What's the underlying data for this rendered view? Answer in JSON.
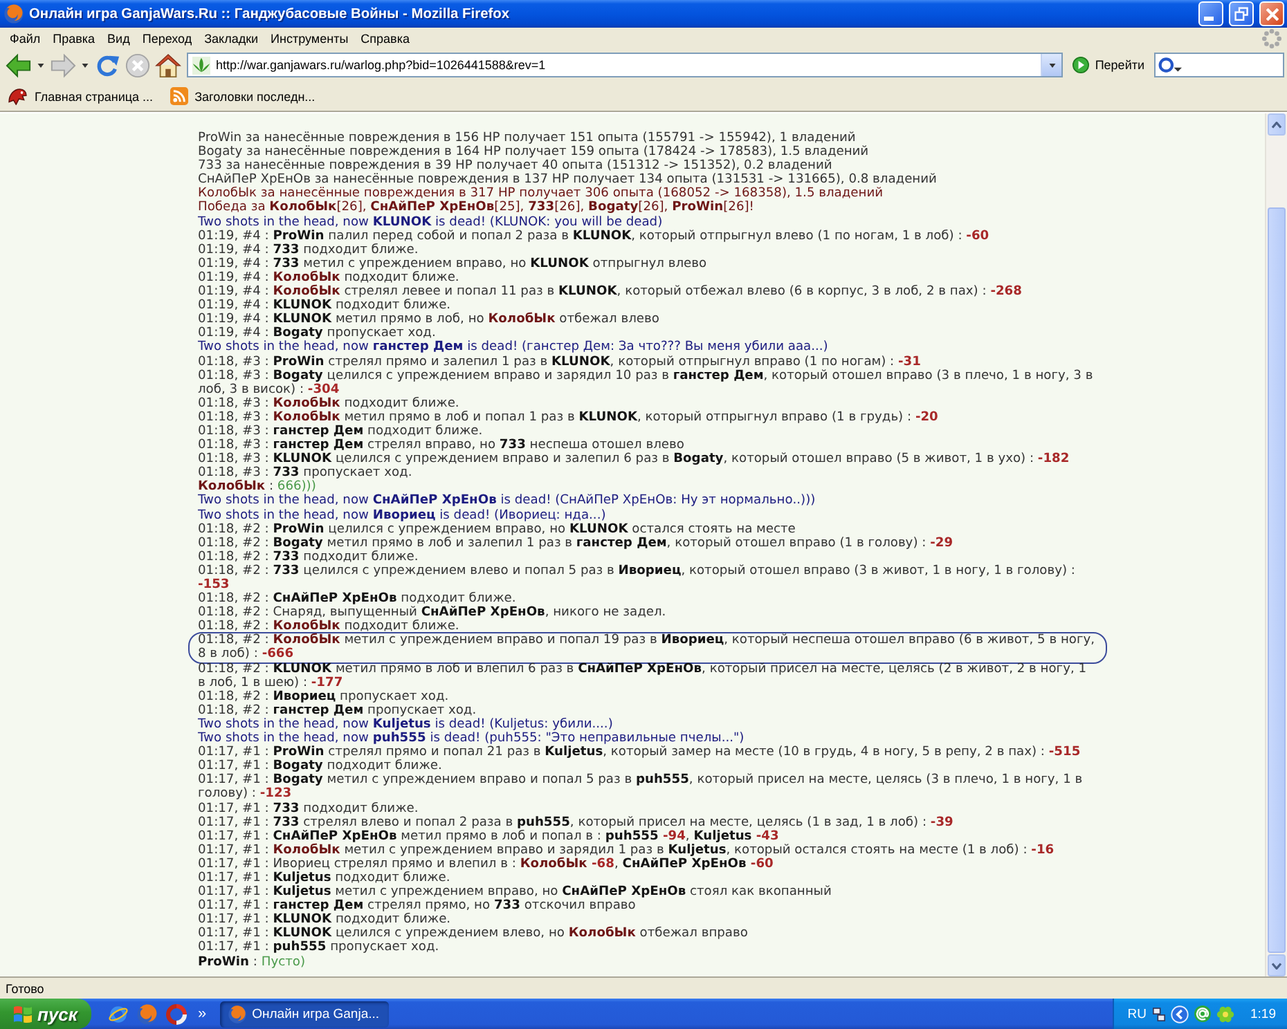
{
  "window": {
    "title": "Онлайн игра GanjaWars.Ru :: Ганджубасовые Войны - Mozilla Firefox"
  },
  "menu": [
    "Файл",
    "Правка",
    "Вид",
    "Переход",
    "Закладки",
    "Инструменты",
    "Справка"
  ],
  "navigation": {
    "buttons": [
      {
        "kind": "back",
        "disabled": false
      },
      {
        "kind": "forward",
        "disabled": true
      },
      {
        "kind": "reload",
        "disabled": false
      },
      {
        "kind": "stop",
        "disabled": true
      },
      {
        "kind": "home",
        "disabled": false
      }
    ],
    "url": "http://war.ganjawars.ru/warlog.php?bid=1026441588&rev=1",
    "go_label": "Перейти"
  },
  "bookmarks": [
    {
      "kind": "site",
      "label": "Главная страница ..."
    },
    {
      "kind": "feed",
      "label": "Заголовки последн..."
    }
  ],
  "log": {
    "lines": [
      {
        "kind": "summary",
        "circled": false,
        "parts": [
          {
            "kind": "text",
            "text": "ProWin за нанесённые повреждения в 156 HP получает 151 опыта (155791 -> 155942), 1 владений"
          }
        ]
      },
      {
        "kind": "summary",
        "circled": false,
        "parts": [
          {
            "kind": "text",
            "text": "Bogaty за нанесённые повреждения в 164 HP получает 159 опыта (178424 -> 178583), 1.5 владений"
          }
        ]
      },
      {
        "kind": "summary",
        "circled": false,
        "parts": [
          {
            "kind": "text",
            "text": "733 за нанесённые повреждения в 39 HP получает 40 опыта (151312 -> 151352), 0.2 владений"
          }
        ]
      },
      {
        "kind": "summary",
        "circled": false,
        "parts": [
          {
            "kind": "text",
            "text": "СнАйПеР ХрЕнОв за нанесённые повреждения в 137 HP получает 134 опыта (131531 -> 131665), 0.8 владений"
          }
        ]
      },
      {
        "kind": "own_summary",
        "circled": false,
        "parts": [
          {
            "kind": "text",
            "text": "КолобЫк за нанесённые повреждения в 317 HP получает 306 опыта (168052 -> 168358), 1.5 владений"
          }
        ]
      },
      {
        "kind": "victory",
        "circled": false,
        "parts": [
          {
            "kind": "text",
            "text": "Победа за "
          },
          {
            "kind": "name",
            "text": "КолобЫк"
          },
          {
            "kind": "text",
            "text": "[26], "
          },
          {
            "kind": "name",
            "text": "СнАйПеР ХрЕнОв"
          },
          {
            "kind": "text",
            "text": "[25], "
          },
          {
            "kind": "name",
            "text": "733"
          },
          {
            "kind": "text",
            "text": "[26], "
          },
          {
            "kind": "name",
            "text": "Bogaty"
          },
          {
            "kind": "text",
            "text": "[26], "
          },
          {
            "kind": "name",
            "text": "ProWin"
          },
          {
            "kind": "text",
            "text": "[26]!"
          }
        ]
      },
      {
        "kind": "death",
        "circled": false,
        "parts": [
          {
            "kind": "text",
            "text": "Two shots in the head, now "
          },
          {
            "kind": "name",
            "text": "KLUNOK"
          },
          {
            "kind": "text",
            "text": " is dead! (KLUNOK: you will be dead)"
          }
        ]
      },
      {
        "kind": "action",
        "circled": false,
        "parts": [
          {
            "kind": "text",
            "text": "01:19, #4 : "
          },
          {
            "kind": "name",
            "text": "ProWin"
          },
          {
            "kind": "text",
            "text": " палил перед собой и попал 2 раза в "
          },
          {
            "kind": "name",
            "text": "KLUNOK"
          },
          {
            "kind": "text",
            "text": ", который отпрыгнул влево (1 по ногам, 1 в лоб) : "
          },
          {
            "kind": "damage",
            "text": "-60"
          }
        ]
      },
      {
        "kind": "action",
        "circled": false,
        "parts": [
          {
            "kind": "text",
            "text": "01:19, #4 : "
          },
          {
            "kind": "name",
            "text": "733"
          },
          {
            "kind": "text",
            "text": " подходит ближе."
          }
        ]
      },
      {
        "kind": "action",
        "circled": false,
        "parts": [
          {
            "kind": "text",
            "text": "01:19, #4 : "
          },
          {
            "kind": "name",
            "text": "733"
          },
          {
            "kind": "text",
            "text": " метил с упреждением вправо, но "
          },
          {
            "kind": "name",
            "text": "KLUNOK"
          },
          {
            "kind": "text",
            "text": " отпрыгнул влево"
          }
        ]
      },
      {
        "kind": "action",
        "circled": false,
        "parts": [
          {
            "kind": "text",
            "text": "01:19, #4 : "
          },
          {
            "kind": "own_name",
            "text": "КолобЫк"
          },
          {
            "kind": "text",
            "text": " подходит ближе."
          }
        ]
      },
      {
        "kind": "action",
        "circled": false,
        "parts": [
          {
            "kind": "text",
            "text": "01:19, #4 : "
          },
          {
            "kind": "own_name",
            "text": "КолобЫк"
          },
          {
            "kind": "text",
            "text": " стрелял левее и попал 11 раз в "
          },
          {
            "kind": "name",
            "text": "KLUNOK"
          },
          {
            "kind": "text",
            "text": ", который отбежал влево (6 в корпус, 3 в лоб, 2 в пах) : "
          },
          {
            "kind": "damage",
            "text": "-268"
          }
        ]
      },
      {
        "kind": "action",
        "circled": false,
        "parts": [
          {
            "kind": "text",
            "text": "01:19, #4 : "
          },
          {
            "kind": "name",
            "text": "KLUNOK"
          },
          {
            "kind": "text",
            "text": " подходит ближе."
          }
        ]
      },
      {
        "kind": "action",
        "circled": false,
        "parts": [
          {
            "kind": "text",
            "text": "01:19, #4 : "
          },
          {
            "kind": "name",
            "text": "KLUNOK"
          },
          {
            "kind": "text",
            "text": " метил прямо в лоб, но "
          },
          {
            "kind": "own_name",
            "text": "КолобЫк"
          },
          {
            "kind": "text",
            "text": " отбежал влево"
          }
        ]
      },
      {
        "kind": "action",
        "circled": false,
        "parts": [
          {
            "kind": "text",
            "text": "01:19, #4 : "
          },
          {
            "kind": "name",
            "text": "Bogaty"
          },
          {
            "kind": "text",
            "text": " пропускает ход."
          }
        ]
      },
      {
        "kind": "death",
        "circled": false,
        "parts": [
          {
            "kind": "text",
            "text": "Two shots in the head, now "
          },
          {
            "kind": "name",
            "text": "ганстер Дем"
          },
          {
            "kind": "text",
            "text": " is dead! (ганстер Дем: За что??? Вы меня убили ааа...)"
          }
        ]
      },
      {
        "kind": "action",
        "circled": false,
        "parts": [
          {
            "kind": "text",
            "text": "01:18, #3 : "
          },
          {
            "kind": "name",
            "text": "ProWin"
          },
          {
            "kind": "text",
            "text": " стрелял прямо и залепил 1 раз в "
          },
          {
            "kind": "name",
            "text": "KLUNOK"
          },
          {
            "kind": "text",
            "text": ", который отпрыгнул вправо (1 по ногам) : "
          },
          {
            "kind": "damage",
            "text": "-31"
          }
        ]
      },
      {
        "kind": "action",
        "circled": false,
        "parts": [
          {
            "kind": "text",
            "text": "01:18, #3 : "
          },
          {
            "kind": "name",
            "text": "Bogaty"
          },
          {
            "kind": "text",
            "text": " целился с упреждением вправо и зарядил 10 раз в "
          },
          {
            "kind": "name",
            "text": "ганстер Дем"
          },
          {
            "kind": "text",
            "text": ", который отошел вправо (3 в плечо, 1 в ногу, 3 в лоб, 3 в висок) : "
          },
          {
            "kind": "damage",
            "text": "-304"
          }
        ]
      },
      {
        "kind": "action",
        "circled": false,
        "parts": [
          {
            "kind": "text",
            "text": "01:18, #3 : "
          },
          {
            "kind": "own_name",
            "text": "КолобЫк"
          },
          {
            "kind": "text",
            "text": " подходит ближе."
          }
        ]
      },
      {
        "kind": "action",
        "circled": false,
        "parts": [
          {
            "kind": "text",
            "text": "01:18, #3 : "
          },
          {
            "kind": "own_name",
            "text": "КолобЫк"
          },
          {
            "kind": "text",
            "text": " метил прямо в лоб и попал 1 раз в "
          },
          {
            "kind": "name",
            "text": "KLUNOK"
          },
          {
            "kind": "text",
            "text": ", который отпрыгнул вправо (1 в грудь) : "
          },
          {
            "kind": "damage",
            "text": "-20"
          }
        ]
      },
      {
        "kind": "action",
        "circled": false,
        "parts": [
          {
            "kind": "text",
            "text": "01:18, #3 : "
          },
          {
            "kind": "name",
            "text": "ганстер Дем"
          },
          {
            "kind": "text",
            "text": " подходит ближе."
          }
        ]
      },
      {
        "kind": "action",
        "circled": false,
        "parts": [
          {
            "kind": "text",
            "text": "01:18, #3 : "
          },
          {
            "kind": "name",
            "text": "ганстер Дем"
          },
          {
            "kind": "text",
            "text": " стрелял вправо, но "
          },
          {
            "kind": "name",
            "text": "733"
          },
          {
            "kind": "text",
            "text": " неспеша отошел влево"
          }
        ]
      },
      {
        "kind": "action",
        "circled": false,
        "parts": [
          {
            "kind": "text",
            "text": "01:18, #3 : "
          },
          {
            "kind": "name",
            "text": "KLUNOK"
          },
          {
            "kind": "text",
            "text": " целился с упреждением вправо и залепил 6 раз в "
          },
          {
            "kind": "name",
            "text": "Bogaty"
          },
          {
            "kind": "text",
            "text": ", который отошел вправо (5 в живот, 1 в ухо) : "
          },
          {
            "kind": "damage",
            "text": "-182"
          }
        ]
      },
      {
        "kind": "action",
        "circled": false,
        "parts": [
          {
            "kind": "text",
            "text": "01:18, #3 : "
          },
          {
            "kind": "name",
            "text": "733"
          },
          {
            "kind": "text",
            "text": " пропускает ход."
          }
        ]
      },
      {
        "kind": "chat",
        "circled": false,
        "parts": [
          {
            "kind": "own_name",
            "text": "КолобЫк"
          },
          {
            "kind": "text",
            "text": " : "
          },
          {
            "kind": "chat",
            "text": "666)))"
          }
        ]
      },
      {
        "kind": "death",
        "circled": false,
        "parts": [
          {
            "kind": "text",
            "text": "Two shots in the head, now "
          },
          {
            "kind": "name",
            "text": "СнАйПеР ХрЕнОв"
          },
          {
            "kind": "text",
            "text": " is dead! (СнАйПеР ХрЕнОв: Ну эт нормально..)))"
          }
        ]
      },
      {
        "kind": "death",
        "circled": false,
        "parts": [
          {
            "kind": "text",
            "text": "Two shots in the head, now "
          },
          {
            "kind": "name",
            "text": "Ивориец"
          },
          {
            "kind": "text",
            "text": " is dead! (Ивориец: нда...)"
          }
        ]
      },
      {
        "kind": "action",
        "circled": false,
        "parts": [
          {
            "kind": "text",
            "text": "01:18, #2 : "
          },
          {
            "kind": "name",
            "text": "ProWin"
          },
          {
            "kind": "text",
            "text": " целился с упреждением вправо, но "
          },
          {
            "kind": "name",
            "text": "KLUNOK"
          },
          {
            "kind": "text",
            "text": " остался стоять на месте"
          }
        ]
      },
      {
        "kind": "action",
        "circled": false,
        "parts": [
          {
            "kind": "text",
            "text": "01:18, #2 : "
          },
          {
            "kind": "name",
            "text": "Bogaty"
          },
          {
            "kind": "text",
            "text": " метил прямо в лоб и залепил 1 раз в "
          },
          {
            "kind": "name",
            "text": "ганстер Дем"
          },
          {
            "kind": "text",
            "text": ", который отошел вправо (1 в голову) : "
          },
          {
            "kind": "damage",
            "text": "-29"
          }
        ]
      },
      {
        "kind": "action",
        "circled": false,
        "parts": [
          {
            "kind": "text",
            "text": "01:18, #2 : "
          },
          {
            "kind": "name",
            "text": "733"
          },
          {
            "kind": "text",
            "text": " подходит ближе."
          }
        ]
      },
      {
        "kind": "action",
        "circled": false,
        "parts": [
          {
            "kind": "text",
            "text": "01:18, #2 : "
          },
          {
            "kind": "name",
            "text": "733"
          },
          {
            "kind": "text",
            "text": " целился с упреждением влево и попал 5 раз в "
          },
          {
            "kind": "name",
            "text": "Ивориец"
          },
          {
            "kind": "text",
            "text": ", который отошел вправо (3 в живот, 1 в ногу, 1 в голову) : "
          },
          {
            "kind": "damage",
            "text": "-153"
          }
        ]
      },
      {
        "kind": "action",
        "circled": false,
        "parts": [
          {
            "kind": "text",
            "text": "01:18, #2 : "
          },
          {
            "kind": "name",
            "text": "СнАйПеР ХрЕнОв"
          },
          {
            "kind": "text",
            "text": " подходит ближе."
          }
        ]
      },
      {
        "kind": "action",
        "circled": false,
        "parts": [
          {
            "kind": "text",
            "text": "01:18, #2 : Снаряд, выпущенный "
          },
          {
            "kind": "name",
            "text": "СнАйПеР ХрЕнОв"
          },
          {
            "kind": "text",
            "text": ", никого не задел."
          }
        ]
      },
      {
        "kind": "action",
        "circled": false,
        "parts": [
          {
            "kind": "text",
            "text": "01:18, #2 : "
          },
          {
            "kind": "own_name",
            "text": "КолобЫк"
          },
          {
            "kind": "text",
            "text": " подходит ближе."
          }
        ]
      },
      {
        "kind": "action",
        "circled": true,
        "parts": [
          {
            "kind": "text",
            "text": "01:18, #2 : "
          },
          {
            "kind": "own_name",
            "text": "КолобЫк"
          },
          {
            "kind": "text",
            "text": " метил с упреждением вправо и попал 19 раз в "
          },
          {
            "kind": "name",
            "text": "Ивориец"
          },
          {
            "kind": "text",
            "text": ", который неспеша отошел вправо (6 в живот, 5 в ногу, 8 в лоб) : "
          },
          {
            "kind": "damage",
            "text": "-666"
          }
        ]
      },
      {
        "kind": "action",
        "circled": false,
        "parts": [
          {
            "kind": "text",
            "text": "01:18, #2 : "
          },
          {
            "kind": "name",
            "text": "KLUNOK"
          },
          {
            "kind": "text",
            "text": " метил прямо в лоб и влепил 6 раз в "
          },
          {
            "kind": "name",
            "text": "СнАйПеР ХрЕнОв"
          },
          {
            "kind": "text",
            "text": ", который присел на месте, целясь (2 в живот, 2 в ногу, 1 в лоб, 1 в шею) : "
          },
          {
            "kind": "damage",
            "text": "-177"
          }
        ]
      },
      {
        "kind": "action",
        "circled": false,
        "parts": [
          {
            "kind": "text",
            "text": "01:18, #2 : "
          },
          {
            "kind": "name",
            "text": "Ивориец"
          },
          {
            "kind": "text",
            "text": " пропускает ход."
          }
        ]
      },
      {
        "kind": "action",
        "circled": false,
        "parts": [
          {
            "kind": "text",
            "text": "01:18, #2 : "
          },
          {
            "kind": "name",
            "text": "ганстер Дем"
          },
          {
            "kind": "text",
            "text": " пропускает ход."
          }
        ]
      },
      {
        "kind": "death",
        "circled": false,
        "parts": [
          {
            "kind": "text",
            "text": "Two shots in the head, now "
          },
          {
            "kind": "name",
            "text": "Kuljetus"
          },
          {
            "kind": "text",
            "text": " is dead! (Kuljetus: убили....)"
          }
        ]
      },
      {
        "kind": "death",
        "circled": false,
        "parts": [
          {
            "kind": "text",
            "text": "Two shots in the head, now "
          },
          {
            "kind": "name",
            "text": "puh555"
          },
          {
            "kind": "text",
            "text": " is dead! (puh555: \"Это неправильные пчелы...\")"
          }
        ]
      },
      {
        "kind": "action",
        "circled": false,
        "parts": [
          {
            "kind": "text",
            "text": "01:17, #1 : "
          },
          {
            "kind": "name",
            "text": "ProWin"
          },
          {
            "kind": "text",
            "text": " стрелял прямо и попал 21 раз в "
          },
          {
            "kind": "name",
            "text": "Kuljetus"
          },
          {
            "kind": "text",
            "text": ", который замер на месте (10 в грудь, 4 в ногу, 5 в репу, 2 в пах) : "
          },
          {
            "kind": "damage",
            "text": "-515"
          }
        ]
      },
      {
        "kind": "action",
        "circled": false,
        "parts": [
          {
            "kind": "text",
            "text": "01:17, #1 : "
          },
          {
            "kind": "name",
            "text": "Bogaty"
          },
          {
            "kind": "text",
            "text": " подходит ближе."
          }
        ]
      },
      {
        "kind": "action",
        "circled": false,
        "parts": [
          {
            "kind": "text",
            "text": "01:17, #1 : "
          },
          {
            "kind": "name",
            "text": "Bogaty"
          },
          {
            "kind": "text",
            "text": " метил с упреждением вправо и попал 5 раз в "
          },
          {
            "kind": "name",
            "text": "puh555"
          },
          {
            "kind": "text",
            "text": ", который присел на месте, целясь (3 в плечо, 1 в ногу, 1 в голову) : "
          },
          {
            "kind": "damage",
            "text": "-123"
          }
        ]
      },
      {
        "kind": "action",
        "circled": false,
        "parts": [
          {
            "kind": "text",
            "text": "01:17, #1 : "
          },
          {
            "kind": "name",
            "text": "733"
          },
          {
            "kind": "text",
            "text": " подходит ближе."
          }
        ]
      },
      {
        "kind": "action",
        "circled": false,
        "parts": [
          {
            "kind": "text",
            "text": "01:17, #1 : "
          },
          {
            "kind": "name",
            "text": "733"
          },
          {
            "kind": "text",
            "text": " стрелял влево и попал 2 раза в "
          },
          {
            "kind": "name",
            "text": "puh555"
          },
          {
            "kind": "text",
            "text": ", который присел на месте, целясь (1 в зад, 1 в лоб) : "
          },
          {
            "kind": "damage",
            "text": "-39"
          }
        ]
      },
      {
        "kind": "action",
        "circled": false,
        "parts": [
          {
            "kind": "text",
            "text": "01:17, #1 : "
          },
          {
            "kind": "name",
            "text": "СнАйПеР ХрЕнОв"
          },
          {
            "kind": "text",
            "text": " метил прямо в лоб и попал в : "
          },
          {
            "kind": "name",
            "text": "puh555"
          },
          {
            "kind": "damage",
            "text": " -94"
          },
          {
            "kind": "text",
            "text": ", "
          },
          {
            "kind": "name",
            "text": "Kuljetus"
          },
          {
            "kind": "damage",
            "text": " -43"
          }
        ]
      },
      {
        "kind": "action",
        "circled": false,
        "parts": [
          {
            "kind": "text",
            "text": "01:17, #1 : "
          },
          {
            "kind": "own_name",
            "text": "КолобЫк"
          },
          {
            "kind": "text",
            "text": " метил с упреждением вправо и зарядил 1 раз в "
          },
          {
            "kind": "name",
            "text": "Kuljetus"
          },
          {
            "kind": "text",
            "text": ", который остался стоять на месте (1 в лоб) : "
          },
          {
            "kind": "damage",
            "text": "-16"
          }
        ]
      },
      {
        "kind": "action",
        "circled": false,
        "parts": [
          {
            "kind": "text",
            "text": "01:17, #1 : Ивориец стрелял прямо и влепил в : "
          },
          {
            "kind": "own_name",
            "text": "КолобЫк"
          },
          {
            "kind": "damage",
            "text": " -68"
          },
          {
            "kind": "text",
            "text": ", "
          },
          {
            "kind": "name",
            "text": "СнАйПеР ХрЕнОв"
          },
          {
            "kind": "damage",
            "text": " -60"
          }
        ]
      },
      {
        "kind": "action",
        "circled": false,
        "parts": [
          {
            "kind": "text",
            "text": "01:17, #1 : "
          },
          {
            "kind": "name",
            "text": "Kuljetus"
          },
          {
            "kind": "text",
            "text": " подходит ближе."
          }
        ]
      },
      {
        "kind": "action",
        "circled": false,
        "parts": [
          {
            "kind": "text",
            "text": "01:17, #1 : "
          },
          {
            "kind": "name",
            "text": "Kuljetus"
          },
          {
            "kind": "text",
            "text": " метил с упреждением вправо, но "
          },
          {
            "kind": "name",
            "text": "СнАйПеР ХрЕнОв"
          },
          {
            "kind": "text",
            "text": " стоял как вкопанный"
          }
        ]
      },
      {
        "kind": "action",
        "circled": false,
        "parts": [
          {
            "kind": "text",
            "text": "01:17, #1 : "
          },
          {
            "kind": "name",
            "text": "ганстер Дем"
          },
          {
            "kind": "text",
            "text": " стрелял прямо, но "
          },
          {
            "kind": "name",
            "text": "733"
          },
          {
            "kind": "text",
            "text": " отскочил вправо"
          }
        ]
      },
      {
        "kind": "action",
        "circled": false,
        "parts": [
          {
            "kind": "text",
            "text": "01:17, #1 : "
          },
          {
            "kind": "name",
            "text": "KLUNOK"
          },
          {
            "kind": "text",
            "text": " подходит ближе."
          }
        ]
      },
      {
        "kind": "action",
        "circled": false,
        "parts": [
          {
            "kind": "text",
            "text": "01:17, #1 : "
          },
          {
            "kind": "name",
            "text": "KLUNOK"
          },
          {
            "kind": "text",
            "text": " целился с упреждением влево, но "
          },
          {
            "kind": "own_name",
            "text": "КолобЫк"
          },
          {
            "kind": "text",
            "text": " отбежал вправо"
          }
        ]
      },
      {
        "kind": "action",
        "circled": false,
        "parts": [
          {
            "kind": "text",
            "text": "01:17, #1 : "
          },
          {
            "kind": "name",
            "text": "puh555"
          },
          {
            "kind": "text",
            "text": " пропускает ход."
          }
        ]
      },
      {
        "kind": "chat",
        "circled": false,
        "parts": [
          {
            "kind": "name",
            "text": "ProWin"
          },
          {
            "kind": "text",
            "text": " : "
          },
          {
            "kind": "chat",
            "text": "Пусто)"
          }
        ]
      }
    ]
  },
  "status_bar": {
    "text": "Готово"
  },
  "taskbar": {
    "start_label": "пуск",
    "more": "»",
    "tasks": [
      {
        "label": "Онлайн игра Ganja...",
        "selected": true
      }
    ],
    "language": "RU",
    "clock": "1:19"
  }
}
